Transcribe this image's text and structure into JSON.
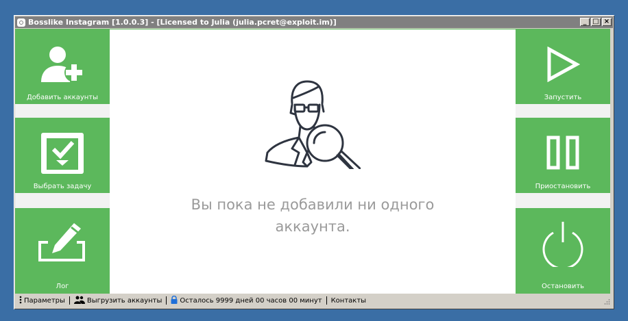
{
  "window": {
    "title": "Bosslike Instagram [1.0.0.3] - [Licensed to Julia (julia.pcret@exploit.im)]",
    "buttons": {
      "minimize": "_",
      "maximize": "□",
      "close": "×"
    }
  },
  "left_panel": {
    "add_accounts": {
      "label": "Добавить аккаунты",
      "icon": "add-user-icon"
    },
    "choose_task": {
      "label": "Выбрать задачу",
      "icon": "checkbox-icon"
    },
    "log": {
      "label": "Лог",
      "icon": "edit-pencil-icon"
    }
  },
  "right_panel": {
    "start": {
      "label": "Запустить",
      "icon": "play-icon"
    },
    "pause": {
      "label": "Приостановить",
      "icon": "pause-icon"
    },
    "stop": {
      "label": "Остановить",
      "icon": "power-icon"
    }
  },
  "main": {
    "empty_line1": "Вы пока не добавили ни одного",
    "empty_line2": "аккаунта.",
    "illustration_icon": "user-search-icon"
  },
  "statusbar": {
    "params": "Параметры",
    "export_accounts": "Выгрузить аккаунты",
    "remaining": "Осталось 9999 дней 00 часов 00 минут",
    "contacts": "Контакты"
  },
  "colors": {
    "accent": "#5cb85c",
    "desktop": "#3a6ea5",
    "text_muted": "#9a9a9a"
  }
}
